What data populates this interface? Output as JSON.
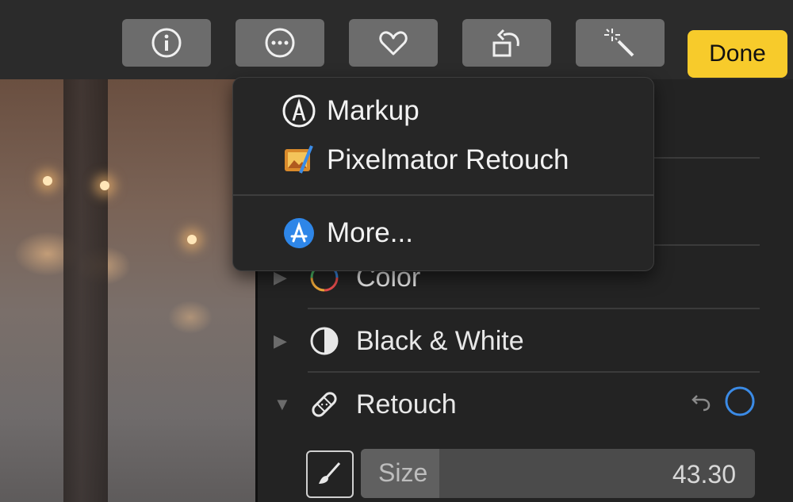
{
  "toolbar": {
    "buttons": [
      {
        "name": "info-icon"
      },
      {
        "name": "more-options-icon"
      },
      {
        "name": "heart-icon"
      },
      {
        "name": "rotate-icon"
      },
      {
        "name": "magic-wand-icon"
      }
    ],
    "done_label": "Done",
    "done_color": "#f7cb2b"
  },
  "menu": {
    "items": [
      {
        "label": "Markup",
        "icon": "markup-icon"
      },
      {
        "label": "Pixelmator Retouch",
        "icon": "pixelmator-icon"
      },
      {
        "label": "More...",
        "icon": "app-store-icon"
      }
    ]
  },
  "adjustments": [
    {
      "label": "Color",
      "icon": "color-wheel-icon",
      "expanded": false
    },
    {
      "label": "Black & White",
      "icon": "half-circle-icon",
      "expanded": false
    },
    {
      "label": "Retouch",
      "icon": "bandage-icon",
      "expanded": true
    }
  ],
  "retouch": {
    "size_label": "Size",
    "size_value": "43.30",
    "size_fraction": 0.2,
    "accent_color": "#3b8be6"
  }
}
